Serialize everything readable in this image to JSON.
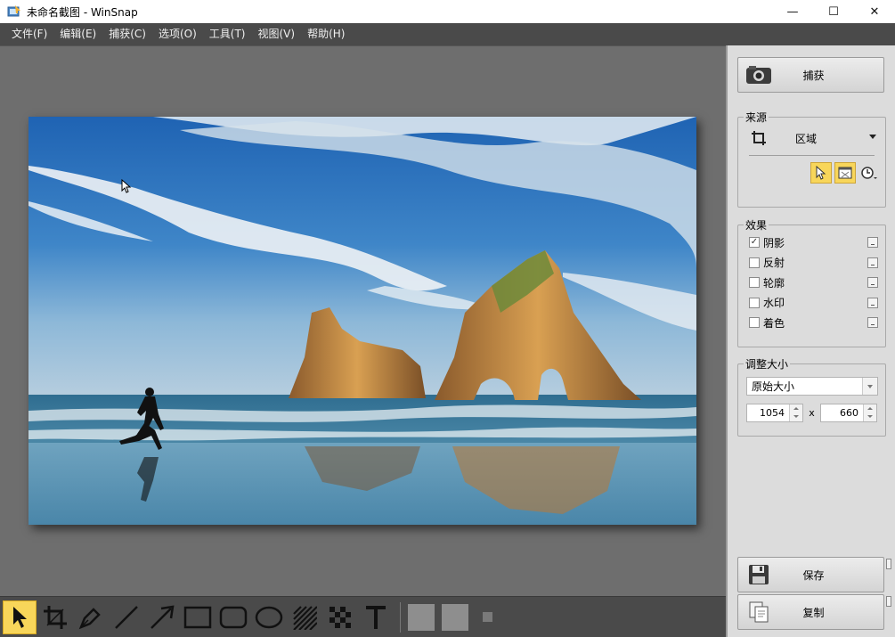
{
  "window": {
    "title": "未命名截图 - WinSnap",
    "controls": {
      "minimize": "—",
      "maximize": "☐",
      "close": "✕"
    }
  },
  "menu": [
    "文件(F)",
    "编辑(E)",
    "捕获(C)",
    "选项(O)",
    "工具(T)",
    "视图(V)",
    "帮助(H)"
  ],
  "panel": {
    "capture_button": "捕获",
    "source": {
      "legend": "来源",
      "mode": "区域"
    },
    "effects": {
      "legend": "效果",
      "items": [
        {
          "label": "阴影",
          "checked": true
        },
        {
          "label": "反射",
          "checked": false
        },
        {
          "label": "轮廓",
          "checked": false
        },
        {
          "label": "水印",
          "checked": false
        },
        {
          "label": "着色",
          "checked": false
        }
      ]
    },
    "resize": {
      "legend": "调整大小",
      "mode": "原始大小",
      "width": "1054",
      "separator": "x",
      "height": "660"
    },
    "save_button": "保存",
    "copy_button": "复制"
  },
  "toolbar": {
    "tools": [
      "pointer-icon",
      "crop-icon",
      "pen-icon",
      "line-icon",
      "arrow-icon",
      "rectangle-icon",
      "rounded-rectangle-icon",
      "ellipse-icon",
      "hatch-icon",
      "pixelate-icon",
      "text-icon"
    ],
    "active_tool": "pointer-icon",
    "colors": {
      "active": "#f8d65a",
      "panel_bg": "#dcdcdc",
      "canvas_bg": "#6e6e6e",
      "menubar_bg": "#4a4a4a"
    }
  }
}
